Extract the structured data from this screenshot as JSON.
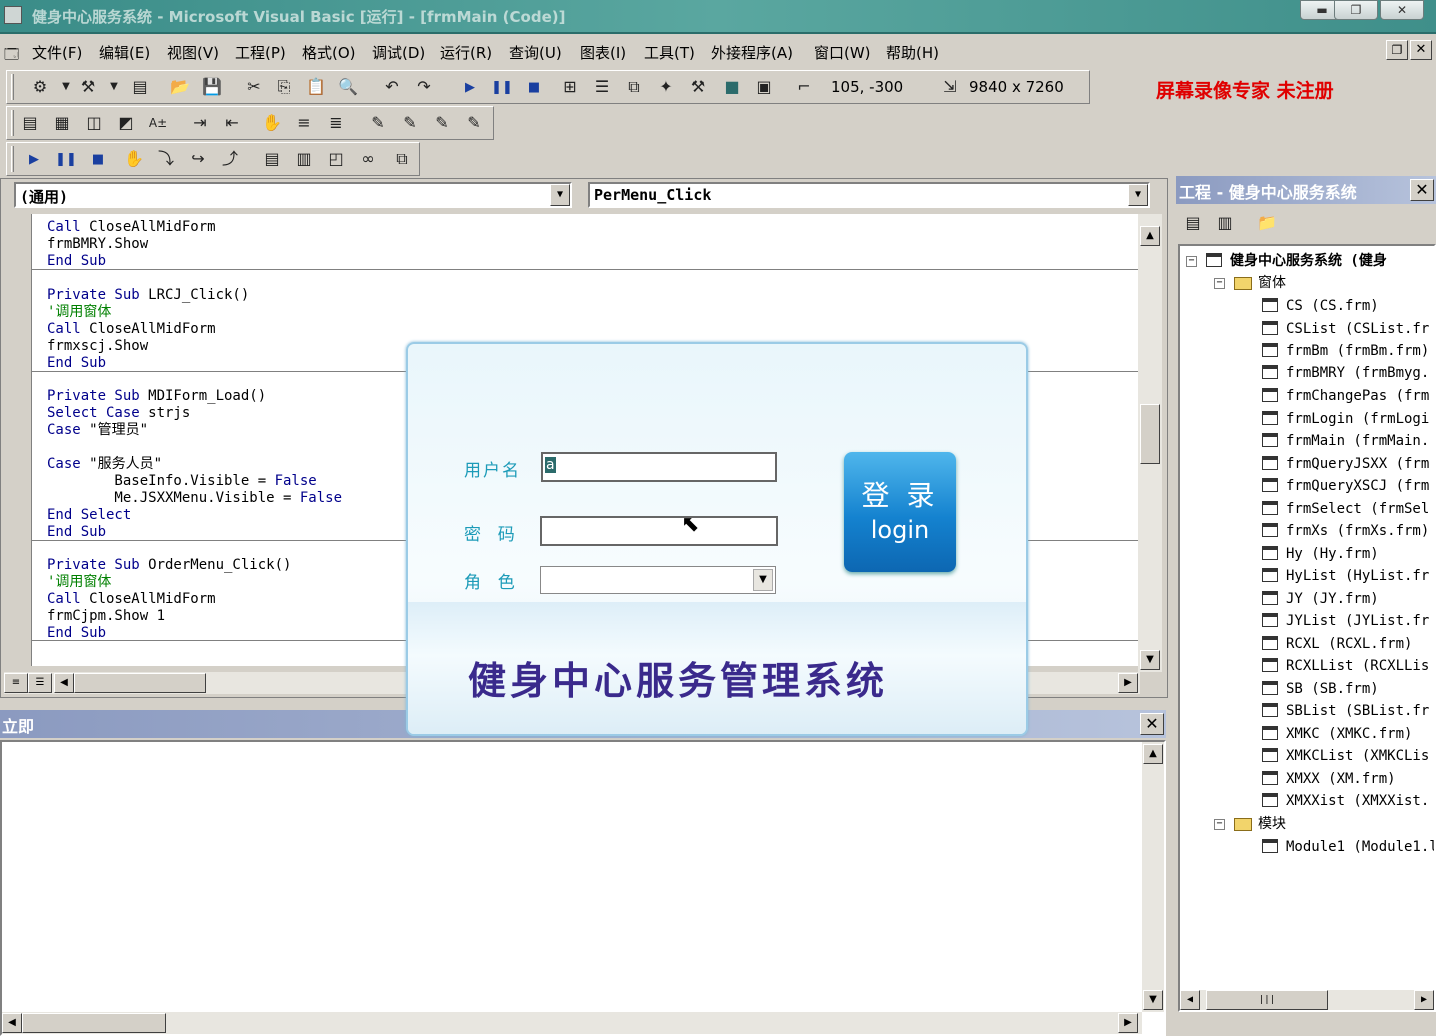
{
  "window": {
    "title": "健身中心服务系统 - Microsoft Visual Basic [运行] - [frmMain (Code)]"
  },
  "menu": [
    "文件(F)",
    "编辑(E)",
    "视图(V)",
    "工程(P)",
    "格式(O)",
    "调试(D)",
    "运行(R)",
    "查询(U)",
    "图表(I)",
    "工具(T)",
    "外接程序(A)",
    "窗口(W)",
    "帮助(H)"
  ],
  "recorder": "屏幕录像专家  未注册",
  "toolbar": {
    "position": "105, -300",
    "size": "9840 x 7260"
  },
  "code_window": {
    "object_combo": "(通用)",
    "proc_combo": "PerMenu_Click",
    "lines": [
      "Call CloseAllMidForm",
      "frmBMRY.Show",
      "End Sub",
      "Private Sub LRCJ_Click()",
      "'调用窗体",
      "Call CloseAllMidForm",
      "frmxscj.Show",
      "End Sub",
      "Private Sub MDIForm_Load()",
      "Select Case strjs",
      "Case \"管理员\"",
      "Case \"服务人员\"",
      "        BaseInfo.Visible = False",
      "        Me.JSXXMenu.Visible = False",
      "End Select",
      "End Sub",
      "Private Sub OrderMenu_Click()",
      "'调用窗体",
      "Call CloseAllMidForm",
      "frmCjpm.Show 1",
      "End Sub"
    ]
  },
  "immediate": {
    "title": "立即"
  },
  "project": {
    "title": "工程 - 健身中心服务系统",
    "root": "健身中心服务系统 (健身",
    "forms_folder": "窗体",
    "forms": [
      "CS (CS.frm)",
      "CSList (CSList.fr",
      "frmBm (frmBm.frm)",
      "frmBMRY (frmBmyg.",
      "frmChangePas (frm",
      "frmLogin (frmLogi",
      "frmMain (frmMain.",
      "frmQueryJSXX (frm",
      "frmQueryXSCJ (frm",
      "frmSelect (frmSel",
      "frmXs (frmXs.frm)",
      "Hy (Hy.frm)",
      "HyList (HyList.fr",
      "JY (JY.frm)",
      "JYList (JYList.fr",
      "RCXL (RCXL.frm)",
      "RCXLList (RCXLLis",
      "SB (SB.frm)",
      "SBList (SBList.fr",
      "XMKC (XMKC.frm)",
      "XMKCList (XMKCLis",
      "XMXX (XM.frm)",
      "XMXXist (XMXXist."
    ],
    "modules_folder": "模块",
    "modules": [
      "Module1 (Module1.l"
    ]
  },
  "login": {
    "username_label": "用户名",
    "username_value": "a",
    "password_label": "密  码",
    "role_label": "角  色",
    "button_cn": "登 录",
    "button_en": "login",
    "banner": "健身中心服务管理系统"
  }
}
